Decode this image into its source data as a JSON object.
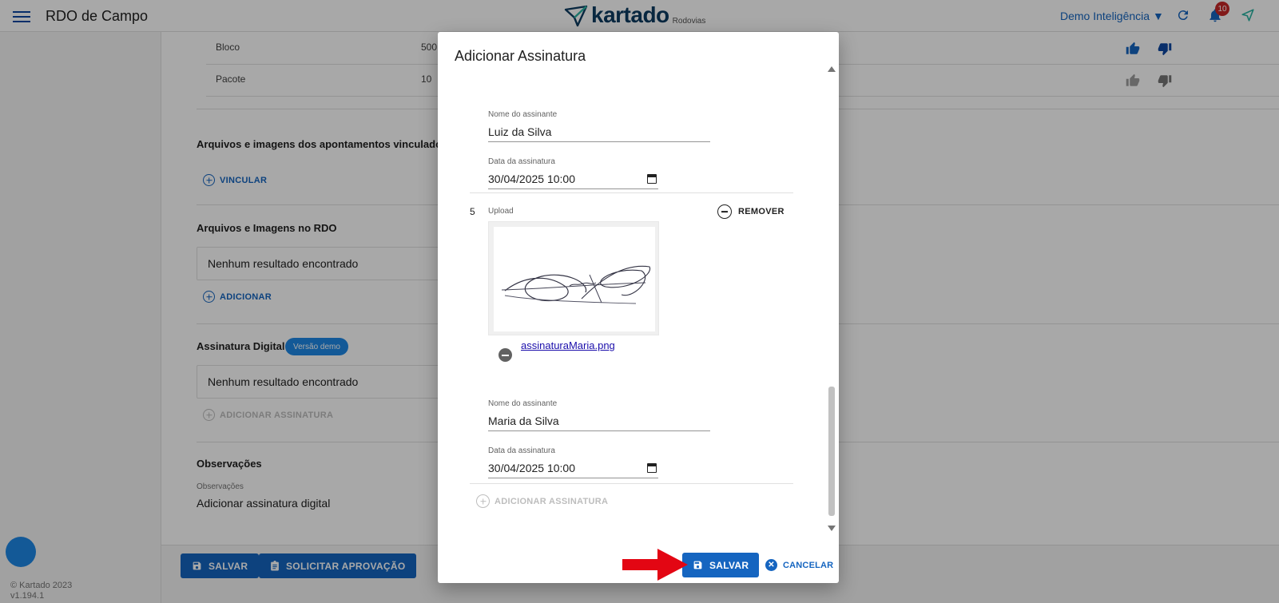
{
  "header": {
    "app_title": "RDO de Campo",
    "logo_text": "kartado",
    "logo_subtext": "Rodovias",
    "user_menu": "Demo Inteligência ▼",
    "notifications_count": "10"
  },
  "footer": {
    "copyright": "© Kartado 2023",
    "version": "v1.194.1"
  },
  "background": {
    "table_rows": [
      {
        "name": "Bloco",
        "value": "500"
      },
      {
        "name": "Pacote",
        "value": "10"
      }
    ],
    "linked_files_title": "Arquivos e imagens dos apontamentos vinculados",
    "link_button": "VINCULAR",
    "rdo_files_title": "Arquivos e Imagens no RDO",
    "rdo_files_empty": "Nenhum resultado encontrado",
    "add_button": "ADICIONAR",
    "signature_title": "Assinatura Digital",
    "signature_chip": "Versão demo",
    "signature_empty": "Nenhum resultado encontrado",
    "add_signature_button": "ADICIONAR ASSINATURA",
    "observations_title": "Observações",
    "observations_label": "Observações",
    "observations_value": "Adicionar assinatura digital",
    "save_button": "SALVAR",
    "request_approval_button": "SOLICITAR APROVAÇÃO"
  },
  "dialog": {
    "title": "Adicionar Assinatura",
    "entry1": {
      "name_label": "Nome do assinante",
      "name_value": "Luiz da Silva",
      "date_label": "Data da assinatura",
      "date_value": "30/04/2025 10:00"
    },
    "entry2": {
      "number": "5",
      "upload_label": "Upload",
      "remove_button": "REMOVER",
      "file_name": "assinaturaMaria.png",
      "name_label": "Nome do assinante",
      "name_value": "Maria da Silva",
      "date_label": "Data da assinatura",
      "date_value": "30/04/2025 10:00"
    },
    "add_signature_button": "ADICIONAR ASSINATURA",
    "save_button": "SALVAR",
    "cancel_button": "CANCELAR"
  },
  "colors": {
    "primary": "#1565c0",
    "badge": "#c62828",
    "arrow": "#e30613"
  }
}
